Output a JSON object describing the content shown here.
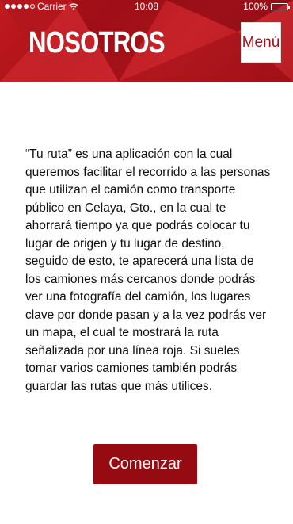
{
  "status_bar": {
    "carrier": "Carrier",
    "time": "10:08",
    "battery": "100%",
    "icons": [
      "signal-dots-icon",
      "wifi-icon",
      "battery-icon"
    ]
  },
  "header": {
    "title": "NOSOTROS",
    "menu_label": "Menú"
  },
  "main": {
    "description": "“Tu ruta” es una aplicación con la cual queremos facilitar el recorrido a las personas que utilizan el camión como transporte público en Celaya, Gto.,  en la cual te ahorrará tiempo ya que podrás colocar tu lugar de origen y tu lugar de destino, seguido de esto, te aparecerá una lista de los camiones más cercanos donde podrás ver una fotografía del camión, los lugares clave por donde pasan y a la vez podrás ver un mapa, el cual te mostrará la ruta señalizada por una línea roja. Si sueles tomar varios camiones también podrás guardar las rutas que más utilices.",
    "start_button": "Comenzar"
  },
  "colors": {
    "header_red": "#c21a1f",
    "button_red": "#960a12",
    "menu_text": "#a30f18"
  }
}
